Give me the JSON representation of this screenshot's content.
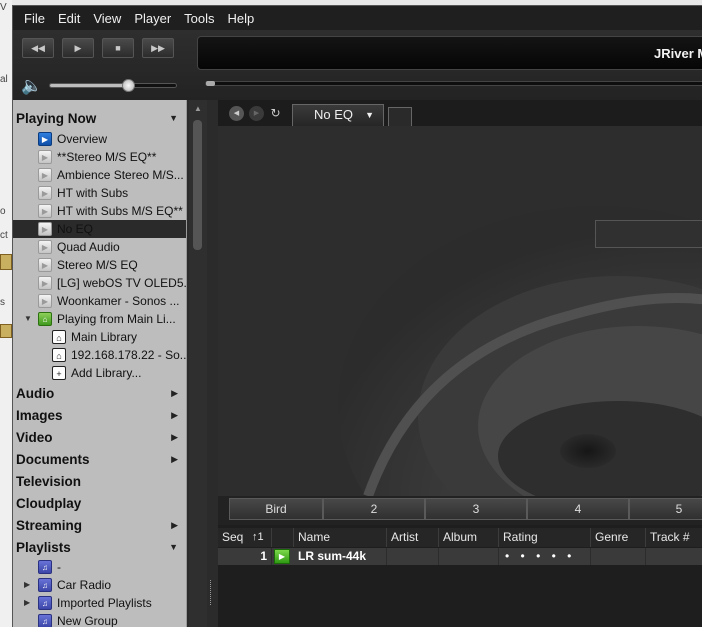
{
  "menu": [
    "File",
    "Edit",
    "View",
    "Player",
    "Tools",
    "Help"
  ],
  "transport": {
    "prev_icon": "previous-track-icon",
    "play_icon": "play-icon",
    "stop_icon": "stop-icon",
    "next_icon": "next-track-icon"
  },
  "display": {
    "title": "JRiver M"
  },
  "volume": {
    "icon": "speaker-icon",
    "level": 0.62
  },
  "position": {
    "level": 0.0
  },
  "sidebar": {
    "playing_now": "Playing Now",
    "items": [
      {
        "label": "Overview",
        "icon": "overview-icon"
      },
      {
        "label": "**Stereo M/S EQ**",
        "icon": "zone-icon"
      },
      {
        "label": "Ambience Stereo M/S...",
        "icon": "zone-icon"
      },
      {
        "label": "HT with Subs",
        "icon": "zone-icon"
      },
      {
        "label": "HT with Subs M/S EQ**",
        "icon": "zone-icon"
      },
      {
        "label": "No EQ",
        "icon": "zone-icon"
      },
      {
        "label": "Quad Audio",
        "icon": "zone-icon"
      },
      {
        "label": "Stereo M/S EQ",
        "icon": "zone-icon"
      },
      {
        "label": "[LG] webOS TV OLED5...",
        "icon": "zone-icon"
      },
      {
        "label": "Woonkamer - Sonos ...",
        "icon": "zone-icon"
      },
      {
        "label": "Playing from Main Li...",
        "icon": "playing-from-library-icon"
      },
      {
        "label": "Main Library",
        "icon": "library-icon"
      },
      {
        "label": "192.168.178.22 - So...",
        "icon": "library-icon"
      },
      {
        "label": "Add Library...",
        "icon": "add-library-icon"
      }
    ],
    "sections": [
      "Audio",
      "Images",
      "Video",
      "Documents",
      "Television",
      "Cloudplay",
      "Streaming",
      "Playlists"
    ],
    "playlists": [
      {
        "label": "-"
      },
      {
        "label": "Car Radio"
      },
      {
        "label": "Imported Playlists"
      },
      {
        "label": "New Group"
      }
    ]
  },
  "main": {
    "eq_tab": "No EQ",
    "alpha_segments": [
      "Bird",
      "2",
      "3",
      "4",
      "5"
    ],
    "columns": [
      "Seq",
      "Name",
      "Artist",
      "Album",
      "Rating",
      "Genre",
      "Track #"
    ],
    "sort_indicator": "↑1",
    "rows": [
      {
        "seq": "1",
        "name": "LR sum-44k",
        "rating": "• • • • •"
      }
    ]
  }
}
